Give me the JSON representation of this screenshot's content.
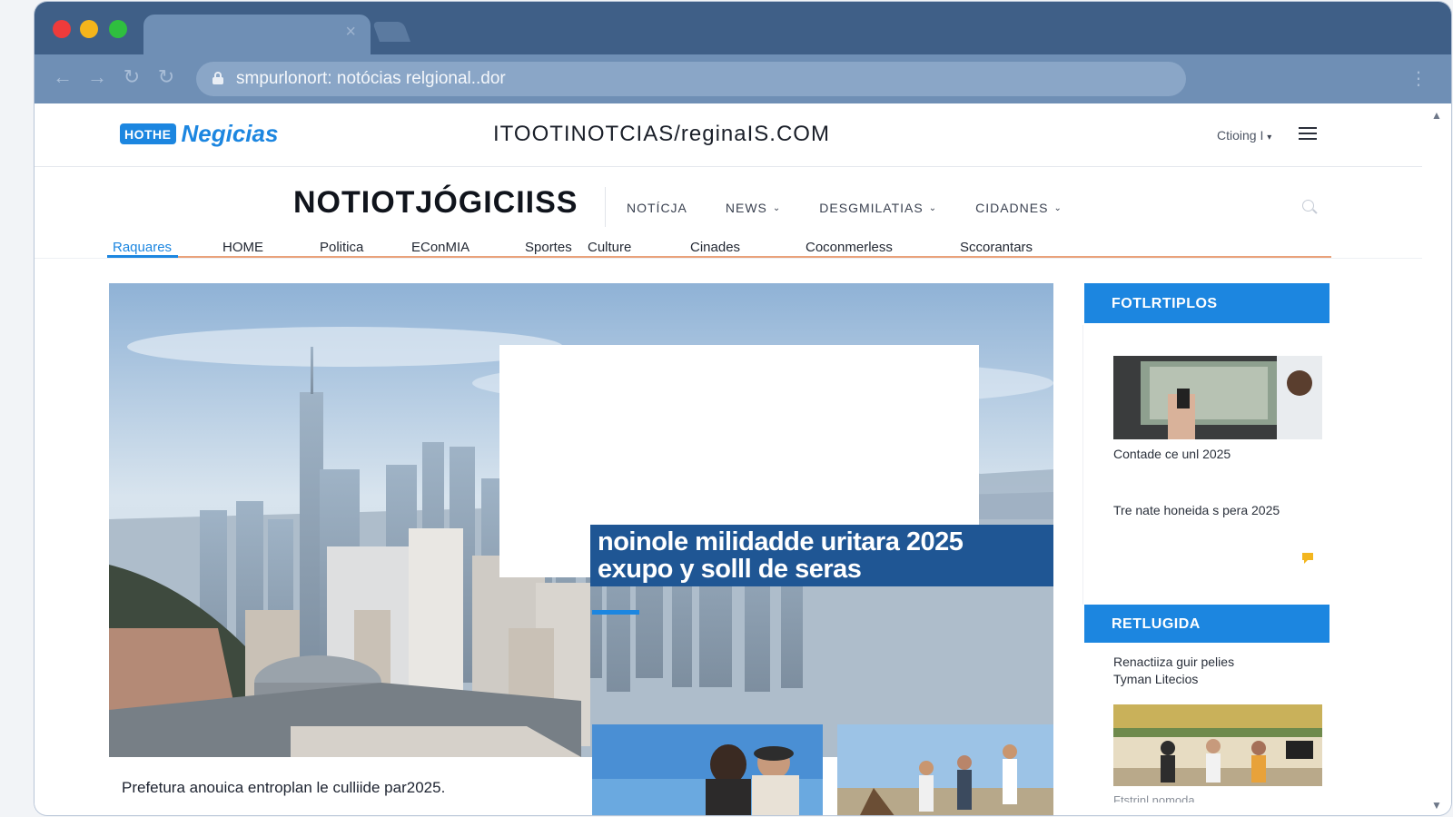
{
  "browser": {
    "address": "smpurlonort: notócias relgional..dor",
    "tab_close": "×",
    "back_icon": "arrow-left-icon",
    "forward_icon": "arrow-right-icon",
    "menu_icon": "kebab-icon"
  },
  "site": {
    "logo_badge": "HOTHE",
    "logo_word": "Negicias",
    "domain_title": "ITOOTINOTCIAS/reginaIS.COM",
    "locale": "Ctioing I",
    "masthead": "NOTIOTJÓGICIISS"
  },
  "top_menu": [
    {
      "label": "NOTÍCJA",
      "dropdown": false
    },
    {
      "label": "NEWS",
      "dropdown": true
    },
    {
      "label": "DESGMILATIAS",
      "dropdown": true
    },
    {
      "label": "CIDADNES",
      "dropdown": true
    }
  ],
  "section_nav": [
    {
      "label": "Raquares",
      "active": true
    },
    {
      "label": "HOME",
      "active": false
    },
    {
      "label": "Politica",
      "active": false
    },
    {
      "label": "EConMIA",
      "active": false
    },
    {
      "label": "Sportes",
      "active": false
    },
    {
      "label": "Culture",
      "active": false
    },
    {
      "label": "Cinades",
      "active": false
    },
    {
      "label": "Coconmerless",
      "active": false
    },
    {
      "label": "Sccorantars",
      "active": false
    }
  ],
  "hero": {
    "headline_line1": "noinole milidadde uritara 2025",
    "headline_line2": "exupo y solll de seras",
    "caption": "Prefetura anouica entroplan le culliide par2025."
  },
  "sidebar": {
    "section1_title": "FOTLRTIPLOS",
    "item1_caption": "Contade ce unl 2025",
    "item2_caption": "Tre nate honeida s pera 2025",
    "section2_title": "RETLUGIDA",
    "item3_line1": "Renactiiza guir pelies",
    "item3_line2": "Tyman Litecios",
    "item4_caption": "Ftstrinl nomoda"
  },
  "colors": {
    "accent": "#1c86e0",
    "headline_bg": "#1f5694",
    "chrome_dark": "#3f5f87",
    "chrome_light": "#6f8fb5",
    "nav_underline": "#e9a27b"
  }
}
